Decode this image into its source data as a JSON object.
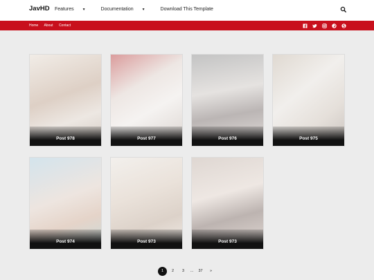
{
  "header": {
    "logo": "JavHD",
    "nav": [
      {
        "label": "Features",
        "dropdown": true
      },
      {
        "label": "Documentation",
        "dropdown": true
      },
      {
        "label": "Download This Template",
        "dropdown": false
      }
    ],
    "search_icon": "search-icon"
  },
  "subnav": {
    "links": [
      "Home",
      "About",
      "Contact"
    ],
    "social_icons": [
      "facebook-icon",
      "twitter-icon",
      "instagram-icon",
      "pinterest-icon",
      "skype-icon"
    ],
    "bar_color": "#c8101d"
  },
  "posts": [
    {
      "title": "Post 978",
      "tint": "#d8c7b9"
    },
    {
      "title": "Post 977",
      "tint": "#d9a9a3"
    },
    {
      "title": "Post 976",
      "tint": "#b9b5b3"
    },
    {
      "title": "Post 975",
      "tint": "#c8c0b6"
    },
    {
      "title": "Post 974",
      "tint": "#c6d6d5"
    },
    {
      "title": "Post 973",
      "tint": "#d7cdbf"
    },
    {
      "title": "Post 973",
      "tint": "#c7b8b1"
    }
  ],
  "pagination": {
    "pages": [
      "1",
      "2",
      "3",
      "...",
      "37",
      "»"
    ],
    "active": "1"
  }
}
